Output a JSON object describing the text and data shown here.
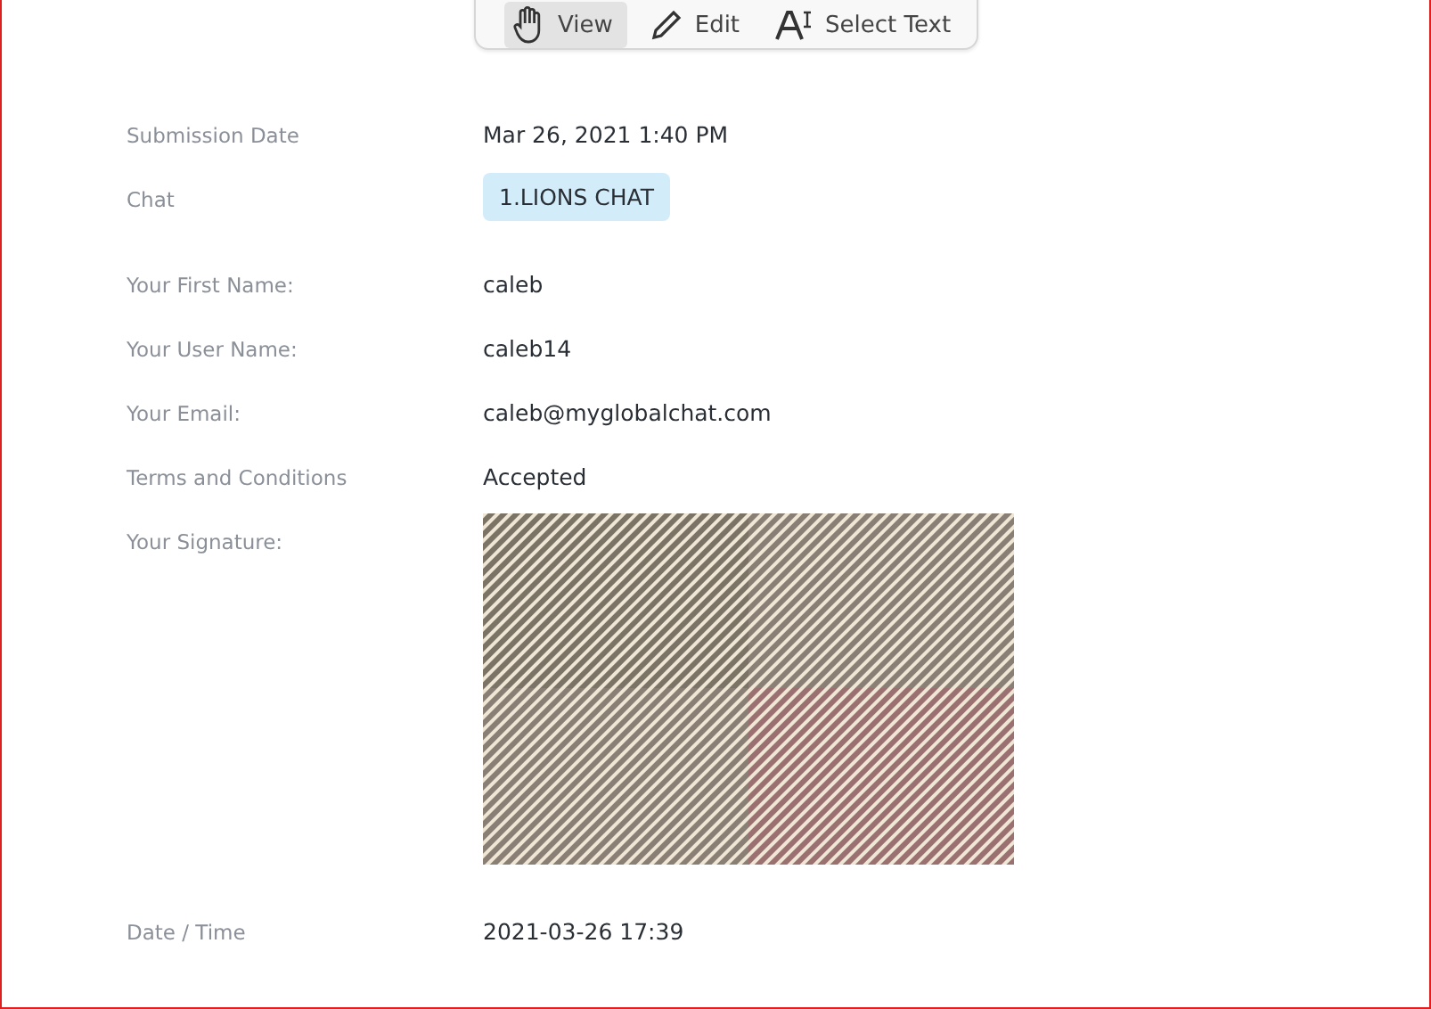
{
  "toolbar": {
    "tools": [
      {
        "kind": "hand",
        "label": "View",
        "selected": true
      },
      {
        "kind": "pencil",
        "label": "Edit",
        "selected": false
      },
      {
        "kind": "text",
        "label": "Select Text",
        "selected": false
      }
    ]
  },
  "fields": [
    {
      "kind": "text",
      "label": "Submission Date",
      "value": "Mar 26, 2021 1:40 PM"
    },
    {
      "kind": "tag",
      "label": "Chat",
      "value": "1.LIONS CHAT"
    },
    {
      "kind": "text",
      "label": "Your First Name:",
      "value": "caleb"
    },
    {
      "kind": "text",
      "label": "Your User Name:",
      "value": "caleb14"
    },
    {
      "kind": "text",
      "label": "Your Email:",
      "value": "caleb@myglobalchat.com"
    },
    {
      "kind": "text",
      "label": "Terms and Conditions",
      "value": "Accepted"
    },
    {
      "kind": "picture",
      "label": "Your Signature:"
    },
    {
      "kind": "text",
      "label": "Date / Time",
      "value": "2021-03-26 17:39"
    }
  ]
}
